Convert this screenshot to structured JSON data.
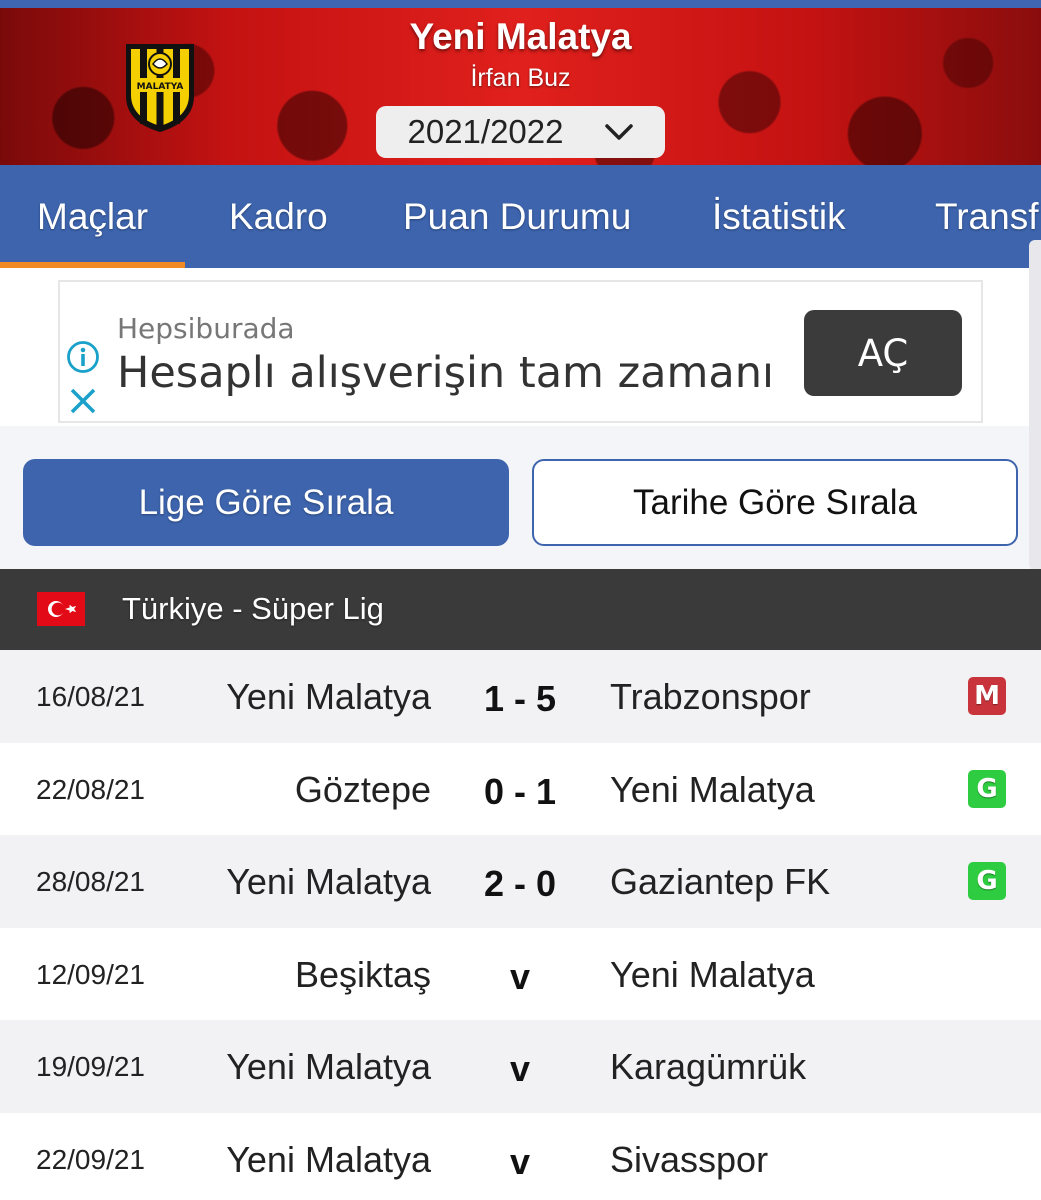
{
  "header": {
    "team": "Yeni Malatya",
    "coach": "İrfan Buz",
    "season": "2021/2022",
    "logo_text": "MALATYA"
  },
  "tabs": [
    {
      "label": "Maçlar",
      "active": true
    },
    {
      "label": "Kadro",
      "active": false
    },
    {
      "label": "Puan Durumu",
      "active": false
    },
    {
      "label": "İstatistik",
      "active": false
    },
    {
      "label": "Transf",
      "active": false
    }
  ],
  "ad": {
    "sponsor": "Hepsiburada",
    "text": "Hesaplı alışverişin tam zamanı",
    "button": "AÇ"
  },
  "sort": {
    "by_league": "Lige Göre Sırala",
    "by_date": "Tarihe Göre Sırala"
  },
  "league": {
    "name": "Türkiye - Süper Lig"
  },
  "matches": [
    {
      "date": "16/08/21",
      "home": "Yeni Malatya",
      "score": "1 - 5",
      "away": "Trabzonspor",
      "result": "M"
    },
    {
      "date": "22/08/21",
      "home": "Göztepe",
      "score": "0 - 1",
      "away": "Yeni Malatya",
      "result": "G"
    },
    {
      "date": "28/08/21",
      "home": "Yeni Malatya",
      "score": "2 - 0",
      "away": "Gaziantep FK",
      "result": "G"
    },
    {
      "date": "12/09/21",
      "home": "Beşiktaş",
      "score": "v",
      "away": "Yeni Malatya",
      "result": ""
    },
    {
      "date": "19/09/21",
      "home": "Yeni Malatya",
      "score": "v",
      "away": "Karagümrük",
      "result": ""
    },
    {
      "date": "22/09/21",
      "home": "Yeni Malatya",
      "score": "v",
      "away": "Sivasspor",
      "result": ""
    }
  ],
  "colors": {
    "primary_blue": "#3d64ad",
    "active_tab_indicator": "#f08a24",
    "win_badge": "#2ecc40",
    "loss_badge": "#c9343c",
    "league_bar": "#3a3a3a"
  }
}
